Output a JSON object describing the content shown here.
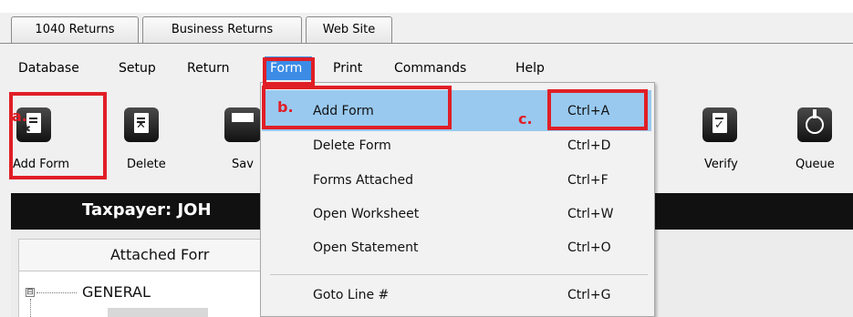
{
  "tabs": [
    {
      "label": "1040 Returns"
    },
    {
      "label": "Business Returns"
    },
    {
      "label": "Web Site"
    }
  ],
  "menubar": [
    {
      "label": "Database"
    },
    {
      "label": "Setup"
    },
    {
      "label": "Return"
    },
    {
      "label": "Form"
    },
    {
      "label": "Print"
    },
    {
      "label": "Commands"
    },
    {
      "label": "Help"
    }
  ],
  "toolbar": [
    {
      "label": "Add Form",
      "icon": "add-form-icon"
    },
    {
      "label": "Delete",
      "icon": "delete-form-icon"
    },
    {
      "label": "Sav",
      "icon": "save-icon"
    },
    {
      "label": "Verify",
      "icon": "verify-icon"
    },
    {
      "label": "Queue",
      "icon": "queue-globe-icon"
    }
  ],
  "taxpayer": {
    "label": "Taxpayer: JOH"
  },
  "attached_forms": {
    "header": "Attached Forr"
  },
  "tree": {
    "toggle": "⊟",
    "root_label": "GENERAL"
  },
  "form_menu": {
    "items": [
      {
        "label": "Add Form",
        "shortcut": "Ctrl+A",
        "highlighted": true
      },
      {
        "label": "Delete Form",
        "shortcut": "Ctrl+D"
      },
      {
        "label": "Forms Attached",
        "shortcut": "Ctrl+F"
      },
      {
        "label": "Open Worksheet",
        "shortcut": "Ctrl+W"
      },
      {
        "label": "Open Statement",
        "shortcut": "Ctrl+O"
      },
      {
        "label": "Goto Line #",
        "shortcut": "Ctrl+G"
      }
    ]
  },
  "annotations": {
    "a": "a.",
    "b": "b.",
    "c": "c."
  },
  "colors": {
    "menu_highlight": "#3c8ce6",
    "item_highlight": "#99c9ef",
    "annotation": "#e01e26",
    "taxpayer_bar": "#111111"
  }
}
